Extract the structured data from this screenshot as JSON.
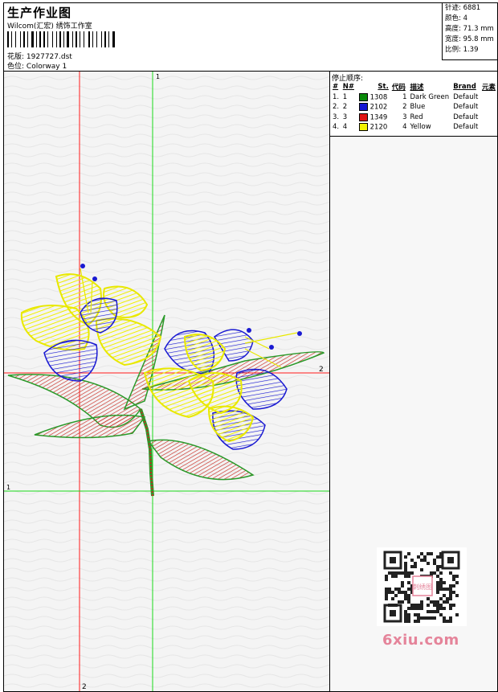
{
  "header": {
    "title": "生产作业图",
    "company": "Wilcom(汇宏) 绣饰工作室",
    "design_label": "花版:",
    "design_value": "1927727.dst",
    "colorway_label": "色位:",
    "colorway_value": "Colorway 1"
  },
  "stats": {
    "stitches": "针迹: 6881",
    "colors": "颜色: 4",
    "height": "高度: 71.3 mm",
    "width": "宽度: 95.8 mm",
    "scale": "比例: 1.39"
  },
  "stop_sequence": {
    "heading": "停止顺序:",
    "columns": [
      "#",
      "N#",
      "St.",
      "代码",
      "描述",
      "Brand",
      "元素"
    ],
    "rows": [
      {
        "num": "1.",
        "n": "1",
        "color": "#0a8a0a",
        "st": "1308",
        "code": "1",
        "desc": "Dark Green",
        "brand": "Default"
      },
      {
        "num": "2.",
        "n": "2",
        "color": "#1414d2",
        "st": "2102",
        "code": "2",
        "desc": "Blue",
        "brand": "Default"
      },
      {
        "num": "3.",
        "n": "3",
        "color": "#e01414",
        "st": "1349",
        "code": "3",
        "desc": "Red",
        "brand": "Default"
      },
      {
        "num": "4.",
        "n": "4",
        "color": "#f2f200",
        "st": "2120",
        "code": "4",
        "desc": "Yellow",
        "brand": "Default"
      }
    ]
  },
  "guides": {
    "green_v_top": "1",
    "red_h_right": "2",
    "green_h_left": "1",
    "red_v_bottom": "2"
  },
  "watermark": {
    "site": "6xiu.com",
    "qr_label": "刺绣图"
  }
}
